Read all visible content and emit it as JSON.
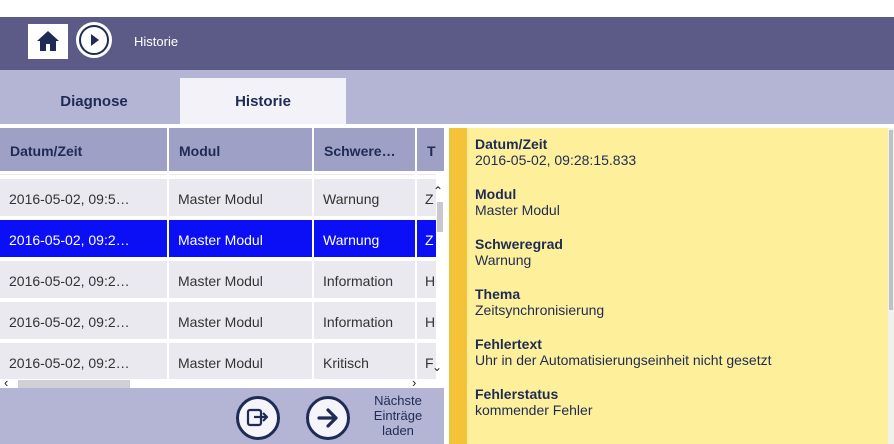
{
  "header": {
    "title": "Historie",
    "home_icon": "home-icon",
    "forward_icon": "play-forward-icon"
  },
  "tabs": [
    {
      "label": "Diagnose",
      "active": false
    },
    {
      "label": "Historie",
      "active": true
    }
  ],
  "table": {
    "columns": [
      "Datum/Zeit",
      "Modul",
      "Schwere…",
      "T"
    ],
    "rows": [
      {
        "datetime": "",
        "module": "",
        "severity": "",
        "topic": "",
        "selected": false
      },
      {
        "datetime": "2016-05-02, 09:5…",
        "module": "Master Modul",
        "severity": "Warnung",
        "topic": "Z",
        "selected": false
      },
      {
        "datetime": "2016-05-02, 09:2…",
        "module": "Master Modul",
        "severity": "Warnung",
        "topic": "Z",
        "selected": true
      },
      {
        "datetime": "2016-05-02, 09:2…",
        "module": "Master Modul",
        "severity": "Information",
        "topic": "H",
        "selected": false
      },
      {
        "datetime": "2016-05-02, 09:2…",
        "module": "Master Modul",
        "severity": "Information",
        "topic": "H",
        "selected": false
      },
      {
        "datetime": "2016-05-02, 09:2…",
        "module": "Master Modul",
        "severity": "Kritisch",
        "topic": "F",
        "selected": false
      }
    ]
  },
  "bottom": {
    "export_icon": "export-icon",
    "next_icon": "arrow-right-icon",
    "next_label": "Nächste Einträge laden"
  },
  "details": {
    "items": [
      {
        "label": "Datum/Zeit",
        "value": "2016-05-02, 09:28:15.833"
      },
      {
        "label": "Modul",
        "value": "Master Modul"
      },
      {
        "label": "Schweregrad",
        "value": "Warnung"
      },
      {
        "label": "Thema",
        "value": "Zeitsynchronisierung"
      },
      {
        "label": "Fehlertext",
        "value": "Uhr in der Automatisierungseinheit nicht gesetzt"
      },
      {
        "label": "Fehlerstatus",
        "value": "kommender Fehler"
      }
    ]
  },
  "colors": {
    "header_bg": "#5c5b88",
    "tab_bg": "#b4b5d4",
    "selected_row": "#0a0ff5",
    "detail_bg": "#fef09a",
    "detail_accent": "#f5c33a"
  }
}
